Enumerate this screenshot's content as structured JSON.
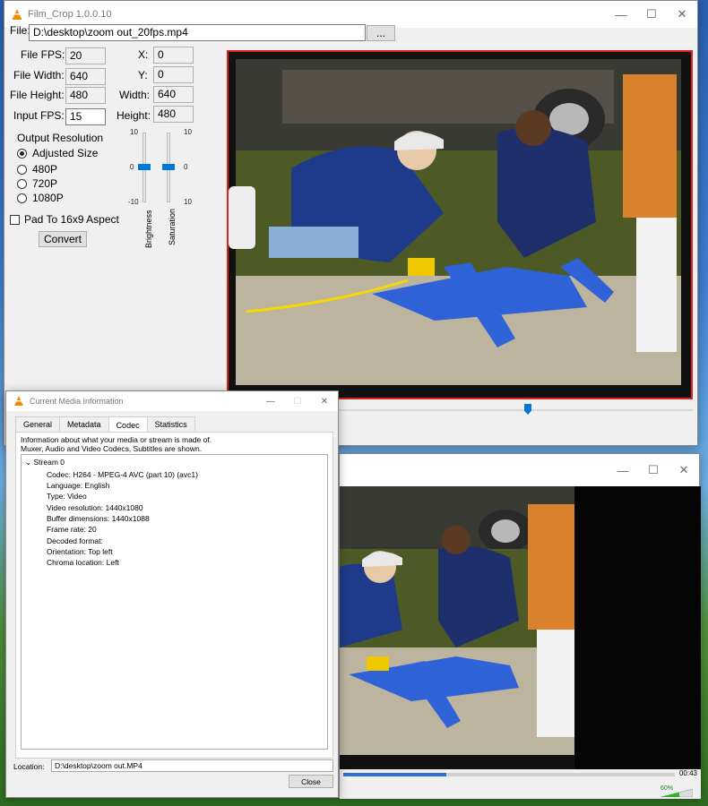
{
  "filmcrop": {
    "title": "Film_Crop 1.0.0.10",
    "file_label": "File:",
    "file_value": "D:\\desktop\\zoom out_20fps.mp4",
    "browse_label": "...",
    "fields": {
      "file_fps_label": "File FPS:",
      "file_fps": "20",
      "file_width_label": "File Width:",
      "file_width": "640",
      "file_height_label": "File Height:",
      "file_height": "480",
      "input_fps_label": "Input FPS:",
      "input_fps": "15",
      "x_label": "X:",
      "x": "0",
      "y_label": "Y:",
      "y": "0",
      "width_label": "Width:",
      "width": "640",
      "height_label": "Height:",
      "height": "480"
    },
    "output_resolution_label": "Output Resolution",
    "resolutions": [
      {
        "label": "Adjusted Size",
        "selected": true
      },
      {
        "label": "480P",
        "selected": false
      },
      {
        "label": "720P",
        "selected": false
      },
      {
        "label": "1080P",
        "selected": false
      }
    ],
    "pad_label": "Pad To 16x9 Aspect",
    "pad_checked": false,
    "convert_label": "Convert",
    "brightness": {
      "label": "Brightness",
      "max": "10",
      "mid": "0",
      "min": "-10",
      "value": 0
    },
    "saturation": {
      "label": "Saturation",
      "max": "10",
      "mid": "0",
      "min": "10",
      "value": 0
    },
    "timeline_position": 0.65
  },
  "mediainfo": {
    "title": "Current Media Information",
    "tabs": [
      "General",
      "Metadata",
      "Codec",
      "Statistics"
    ],
    "active_tab": "Codec",
    "description": [
      "Information about what your media or stream is made of.",
      "Muxer, Audio and Video Codecs, Subtitles are shown."
    ],
    "stream_label": "Stream 0",
    "rows": [
      "Codec: H264 - MPEG-4 AVC (part 10) (avc1)",
      "Language: English",
      "Type: Video",
      "Video resolution: 1440x1080",
      "Buffer dimensions: 1440x1088",
      "Frame rate: 20",
      "Decoded format:",
      "Orientation: Top left",
      "Chroma location: Left"
    ],
    "location_label": "Location:",
    "location_value": "D:\\desktop\\zoom out.MP4",
    "close_label": "Close"
  },
  "player": {
    "time": "00:43",
    "volume": "60%",
    "progress": 0.31
  },
  "colors": {
    "accent": "#0078d7",
    "preview_border": "#e02020",
    "vlc_orange": "#f08a00"
  }
}
